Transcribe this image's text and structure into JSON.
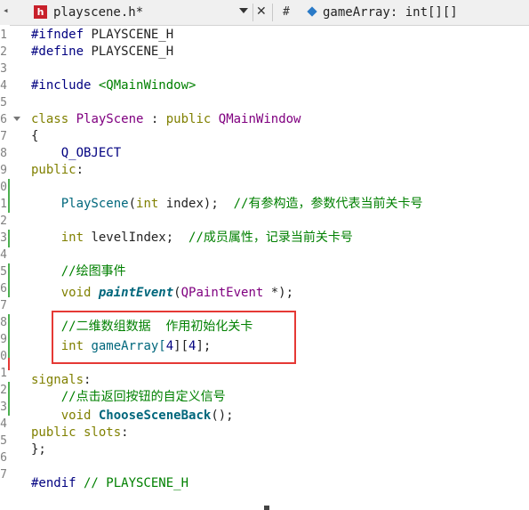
{
  "tabbar": {
    "file_icon_letter": "h",
    "file_name": "playscene.h*",
    "hash_symbol": "#",
    "symbol_name": "gameArray: int[][]"
  },
  "line_numbers": [
    "1",
    "2",
    "3",
    "4",
    "5",
    "6",
    "7",
    "8",
    "9",
    "0",
    "1",
    "2",
    "3",
    "4",
    "5",
    "6",
    "7",
    "8",
    "9",
    "0",
    "1",
    "2",
    "3",
    "4",
    "5",
    "6",
    "7"
  ],
  "code": {
    "l1_pp": "#ifndef",
    "l1_rest": " PLAYSCENE_H",
    "l2_pp": "#define",
    "l2_rest": " PLAYSCENE_H",
    "l4_pp": "#include",
    "l4_str": " <QMainWindow>",
    "l6_kw": "class",
    "l6_cls": "PlayScene",
    "l6_colon": " : ",
    "l6_kw2": "public",
    "l6_base": "QMainWindow",
    "l7": "{",
    "l8": "    Q_OBJECT",
    "l9_kw": "public",
    "l9_colon": ":",
    "l11_fn": "PlayScene",
    "l11_open": "(",
    "l11_kw": "int",
    "l11_rest": " index);",
    "l11_cm": "//有参构造，参数代表当前关卡号",
    "l13_kw": "int",
    "l13_rest": " levelIndex;",
    "l13_cm": "//成员属性，记录当前关卡号",
    "l15_cm": "//绘图事件",
    "l16_kw": "void",
    "l16_fn": "paintEvent",
    "l16_open": "(",
    "l16_cls": "QPaintEvent",
    "l16_rest": " *);",
    "l18_cm": "//二维数组数据  作用初始化关卡",
    "l19_kw": "int",
    "l19_name": " gameArray[",
    "l19_n1": "4",
    "l19_mid": "][",
    "l19_n2": "4",
    "l19_end": "];",
    "l21_kw": "signals",
    "l21_colon": ":",
    "l22_cm": "//点击返回按钮的自定义信号",
    "l23_kw": "void",
    "l23_fn": "ChooseSceneBack",
    "l23_rest": "();",
    "l24_kw": "public slots",
    "l24_colon": ":",
    "l25": "};",
    "l27_pp": "#endif",
    "l27_cm": " // PLAYSCENE_H"
  },
  "colors": {
    "keyword": "#808000",
    "string": "#008000",
    "comment": "#008000",
    "class": "#800080",
    "preprocessor": "#000080",
    "function": "#00677c",
    "highlight_box": "#e53935",
    "modified_marker": "#4caf50",
    "changed_marker": "#e53935"
  }
}
